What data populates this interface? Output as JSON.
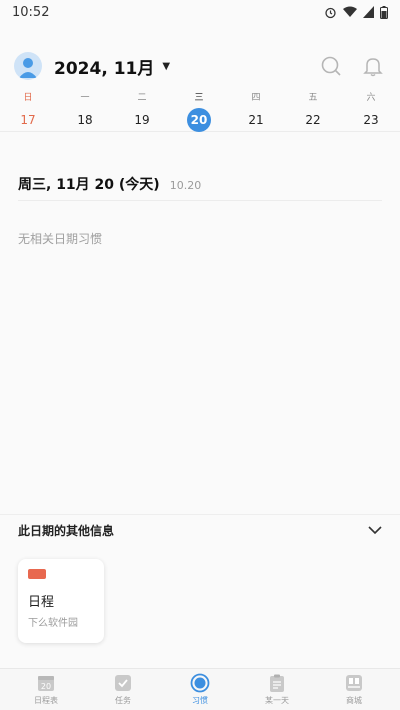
{
  "status_bar": {
    "time": "10:52"
  },
  "header": {
    "month_title": "2024, 11月"
  },
  "calendar": {
    "weekdays": [
      "日",
      "一",
      "二",
      "三",
      "四",
      "五",
      "六"
    ],
    "dates": [
      "17",
      "18",
      "19",
      "20",
      "21",
      "22",
      "23"
    ],
    "selected_index": 3
  },
  "day": {
    "title": "周三, 11月 20 (今天)",
    "sub": "10.20",
    "empty_text": "无相关日期习惯"
  },
  "info": {
    "title": "此日期的其他信息",
    "card": {
      "title": "日程",
      "subtitle": "下么软件园",
      "chip_color": "#e8684f"
    }
  },
  "nav": {
    "items": [
      {
        "label": "日程表",
        "icon": "calendar-icon",
        "badge": "20"
      },
      {
        "label": "任务",
        "icon": "check-icon"
      },
      {
        "label": "习惯",
        "icon": "habit-circle-icon"
      },
      {
        "label": "某一天",
        "icon": "clipboard-icon"
      },
      {
        "label": "商城",
        "icon": "store-icon"
      }
    ],
    "active_index": 2
  },
  "colors": {
    "accent": "#3d8fe0",
    "sunday": "#e26a4b"
  }
}
